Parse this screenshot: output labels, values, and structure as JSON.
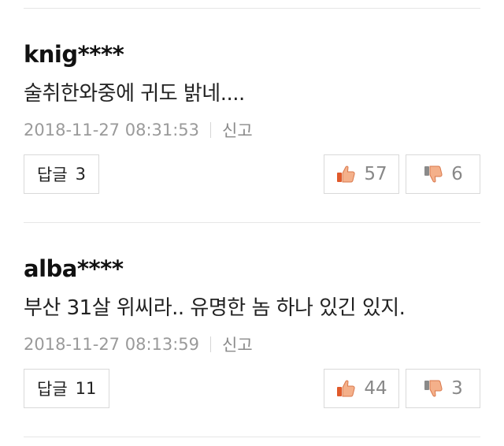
{
  "comments": [
    {
      "author": "knig****",
      "text": "술취한와중에 귀도 밝네....",
      "timestamp": "2018-11-27 08:31:53",
      "report_label": "신고",
      "reply_label": "답글",
      "reply_count": "3",
      "like_count": "57",
      "dislike_count": "6"
    },
    {
      "author": "alba****",
      "text": "부산 31살 위씨라.. 유명한 놈 하나 있긴 있지.",
      "timestamp": "2018-11-27 08:13:59",
      "report_label": "신고",
      "reply_label": "답글",
      "reply_count": "11",
      "like_count": "44",
      "dislike_count": "3"
    }
  ],
  "colors": {
    "like_icon": "#e8734a",
    "dislike_icon": "#e8734a",
    "border": "#d9d9d9",
    "meta_text": "#9a9a9a"
  },
  "icons": {
    "like": "thumbs-up-icon",
    "dislike": "thumbs-down-icon"
  }
}
